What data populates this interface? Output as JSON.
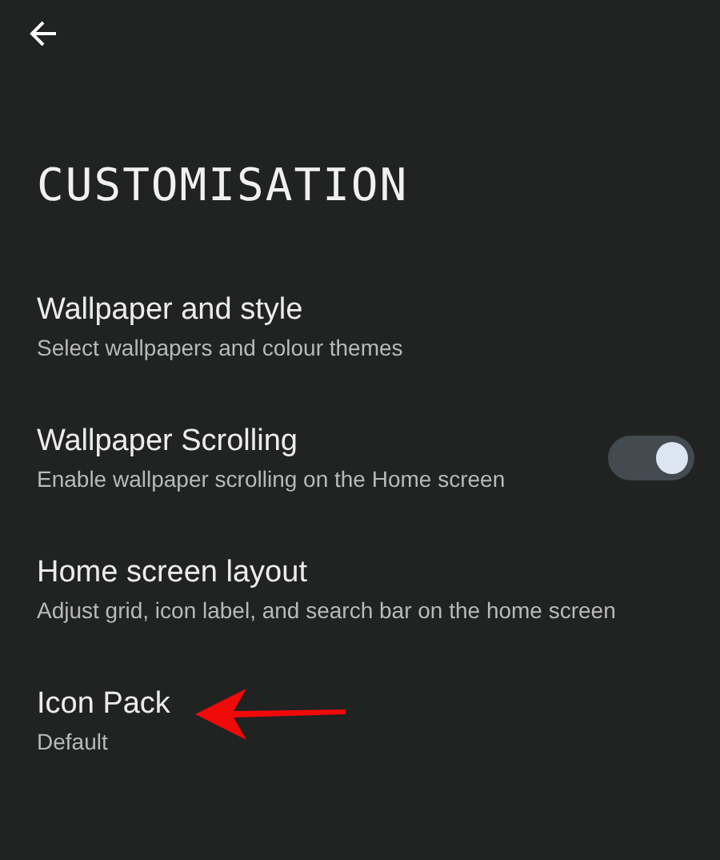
{
  "title": "CUSTOMISATION",
  "items": [
    {
      "kind": "link",
      "title": "Wallpaper and style",
      "subtitle": "Select wallpapers and colour themes"
    },
    {
      "kind": "toggle",
      "title": "Wallpaper Scrolling",
      "subtitle": "Enable wallpaper scrolling on the Home screen",
      "on": true
    },
    {
      "kind": "link",
      "title": "Home screen layout",
      "subtitle": "Adjust grid, icon label, and search bar on the home screen"
    },
    {
      "kind": "link",
      "title": "Icon Pack",
      "subtitle": "Default"
    }
  ]
}
